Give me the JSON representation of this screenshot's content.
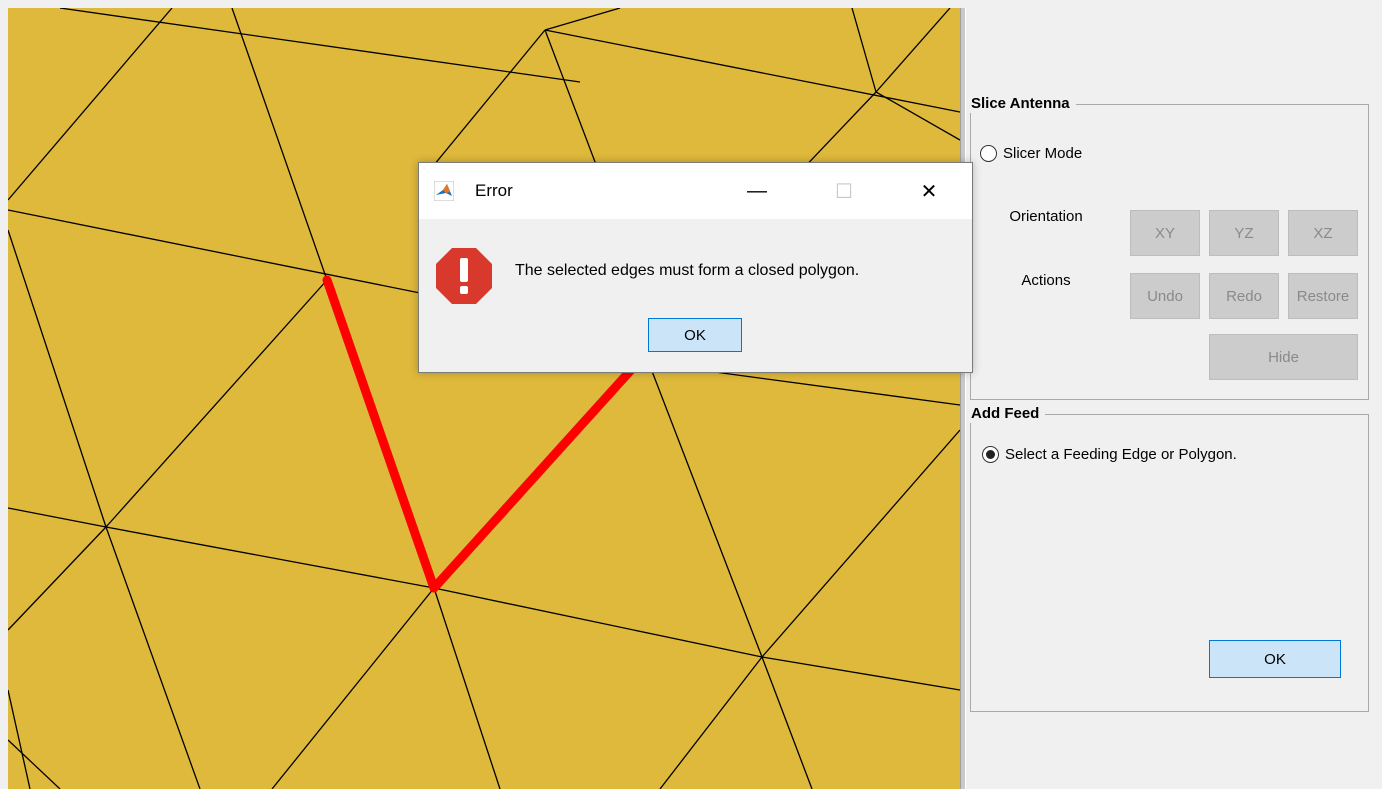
{
  "dialog": {
    "title": "Error",
    "message": "The selected edges must form a closed polygon.",
    "ok_label": "OK",
    "minimize_glyph": "—",
    "maximize_glyph": "☐",
    "close_glyph": "✕",
    "icon": "error-stop-icon"
  },
  "panel": {
    "slice_antenna": {
      "title": "Slice Antenna",
      "slicer_mode_label": "Slicer Mode",
      "slicer_mode_checked": false,
      "orientation_label": "Orientation",
      "actions_label": "Actions",
      "orientation_buttons": [
        "XY",
        "YZ",
        "XZ"
      ],
      "action_buttons": [
        "Undo",
        "Redo",
        "Restore"
      ],
      "hide_label": "Hide"
    },
    "add_feed": {
      "title": "Add Feed",
      "select_label": "Select a Feeding Edge or Polygon.",
      "select_checked": true,
      "ok_label": "OK"
    }
  },
  "colors": {
    "mesh_fill": "#dfb93b",
    "mesh_edge": "#000000",
    "selected_edge": "#ff0000",
    "primary_button_bg": "#cce4f7",
    "primary_button_border": "#0078d7"
  }
}
